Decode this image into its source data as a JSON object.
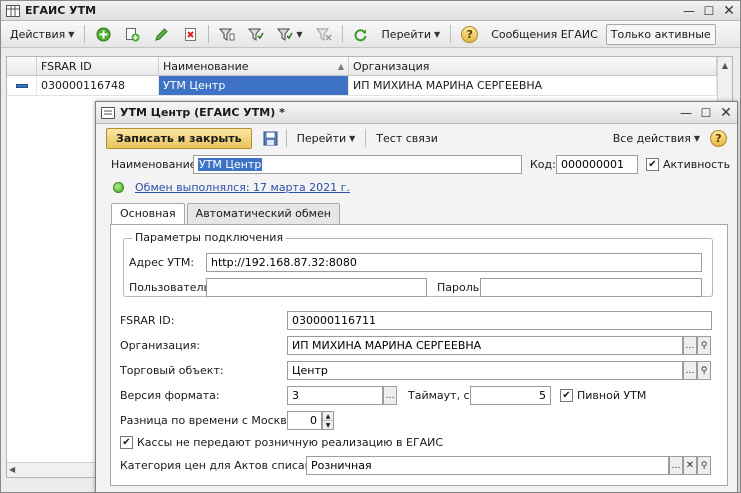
{
  "main_window": {
    "title": "ЕГАИС УТМ",
    "toolbar": {
      "actions_label": "Действия",
      "goto_label": "Перейти",
      "messages_label": "Сообщения ЕГАИС",
      "only_active_label": "Только активные"
    },
    "table": {
      "columns": [
        "FSRAR ID",
        "Наименование",
        "Организация"
      ],
      "rows": [
        {
          "fsrar_id": "030000116748",
          "name": "УТМ Центр",
          "organization": "ИП МИХИНА МАРИНА СЕРГЕЕВНА"
        }
      ]
    }
  },
  "dialog": {
    "title": "УТМ Центр (ЕГАИС УТМ) *",
    "toolbar": {
      "save_close_label": "Записать и закрыть",
      "goto_label": "Перейти",
      "test_label": "Тест связи",
      "all_actions_label": "Все действия"
    },
    "name_label": "Наименование:",
    "name_value": "УТМ Центр",
    "code_label": "Код:",
    "code_value": "000000001",
    "active_label": "Активность",
    "active_checked": true,
    "exchange_status": "Обмен выполнялся: 17 марта 2021 г.",
    "tabs": [
      "Основная",
      "Автоматический обмен"
    ],
    "connection": {
      "group_title": "Параметры подключения",
      "address_label": "Адрес УТМ:",
      "address_value": "http://192.168.87.32:8080",
      "user_label": "Пользователь:",
      "user_value": "",
      "password_label": "Пароль:",
      "password_value": ""
    },
    "fsrar_label": "FSRAR ID:",
    "fsrar_value": "030000116711",
    "org_label": "Организация:",
    "org_value": "ИП МИХИНА МАРИНА СЕРГЕЕВНА",
    "trade_label": "Торговый объект:",
    "trade_value": "Центр",
    "format_label": "Версия формата:",
    "format_value": "3",
    "timeout_label": "Таймаут, с:",
    "timeout_value": "5",
    "beer_label": "Пивной УТМ",
    "beer_checked": true,
    "timediff_label": "Разница по времени с Москвой:",
    "timediff_value": "0",
    "kassa_label": "Кассы не передают розничную реализацию в ЕГАИС",
    "kassa_checked": true,
    "price_label": "Категория цен для Актов списания:",
    "price_value": "Розничная"
  }
}
